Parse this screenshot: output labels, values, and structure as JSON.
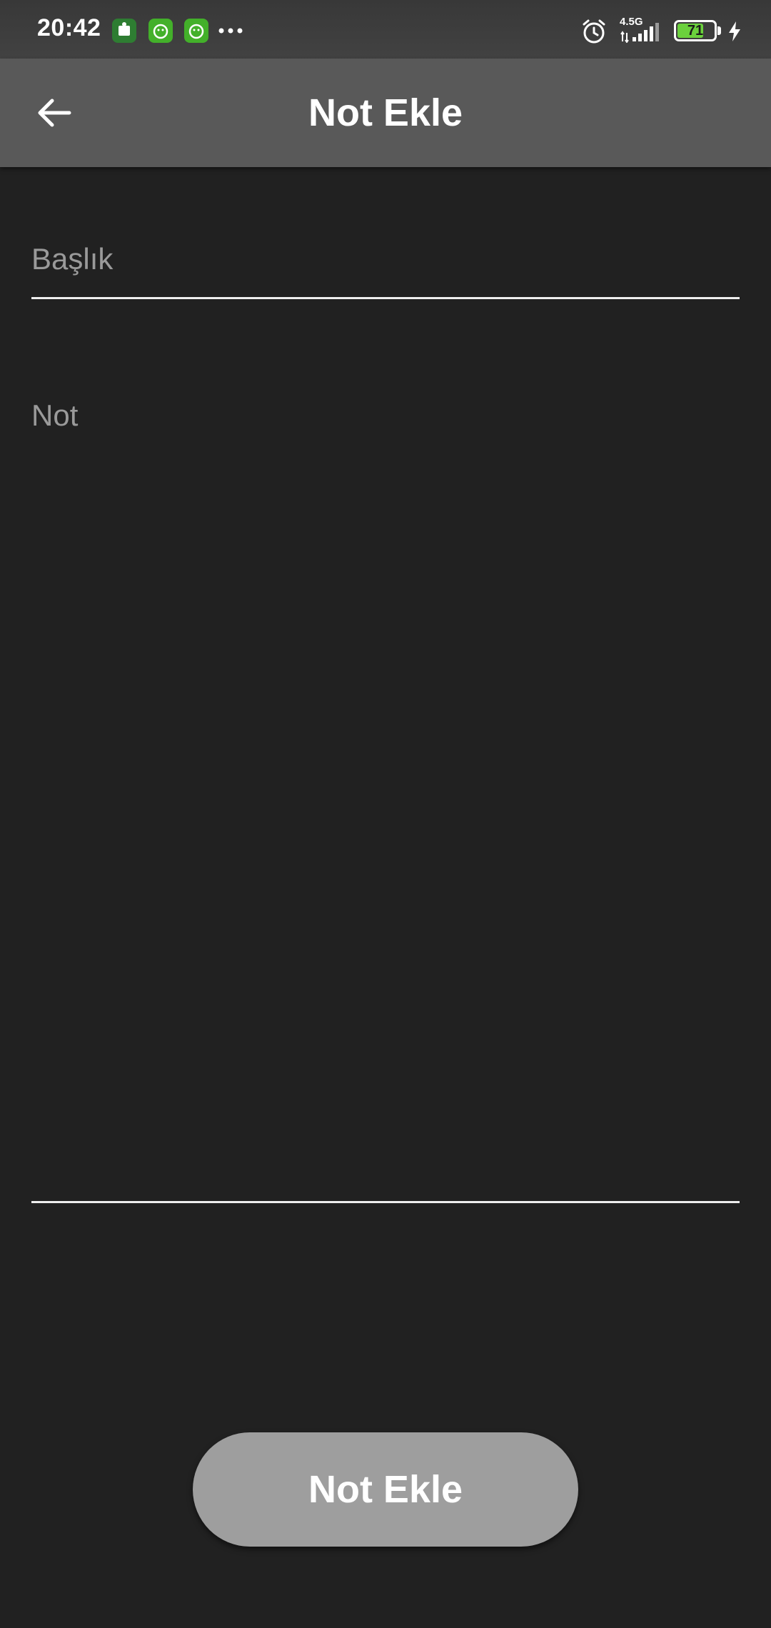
{
  "status_bar": {
    "time": "20:42",
    "network": "4.5G",
    "battery": "71",
    "battery_level": 0.71,
    "icons": [
      "app-notification-icon",
      "app-notification-icon",
      "app-notification-icon",
      "more-notifications-icon",
      "alarm-icon",
      "signal-icon",
      "battery-icon",
      "charging-icon"
    ]
  },
  "app_bar": {
    "title": "Not Ekle",
    "back_icon": "arrow-left-icon"
  },
  "form": {
    "title_placeholder": "Başlık",
    "title_value": "",
    "note_placeholder": "Not",
    "note_value": ""
  },
  "actions": {
    "add_note_label": "Not Ekle"
  },
  "colors": {
    "background": "#212121",
    "app_bar": "#595959",
    "status_bar": "#424242",
    "button": "#9e9e9e",
    "placeholder": "#9a9a9a",
    "battery_fill": "#6bd13d"
  }
}
